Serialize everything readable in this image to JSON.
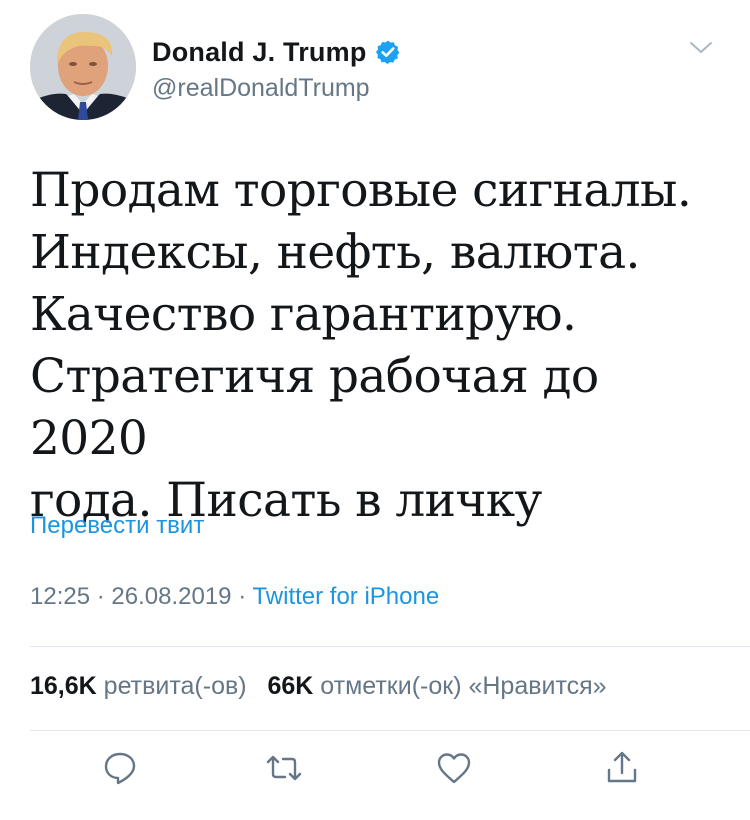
{
  "user": {
    "display_name": "Donald J. Trump",
    "handle": "@realDonaldTrump",
    "verified": true
  },
  "tweet": {
    "text": "Продам торговые сигналы.\nИндексы, нефть, валюта.\nКачество гарантирую.\nСтратегичя рабочая до 2020\nгода. Писать в личку",
    "translate_label": "Перевести твит",
    "time": "12:25",
    "date": "26.08.2019",
    "separator": "·",
    "source": "Twitter for iPhone"
  },
  "stats": {
    "retweets_count": "16,6K",
    "retweets_label": "ретвита(-ов)",
    "likes_count": "66K",
    "likes_label": "отметки(-ок) «Нравится»"
  },
  "actions": [
    {
      "icon": "reply-icon"
    },
    {
      "icon": "retweet-icon"
    },
    {
      "icon": "like-icon"
    },
    {
      "icon": "share-icon"
    }
  ],
  "colors": {
    "link": "#1b95e0",
    "secondary": "#657786",
    "text": "#14171a",
    "divider": "#e1e8ed"
  }
}
